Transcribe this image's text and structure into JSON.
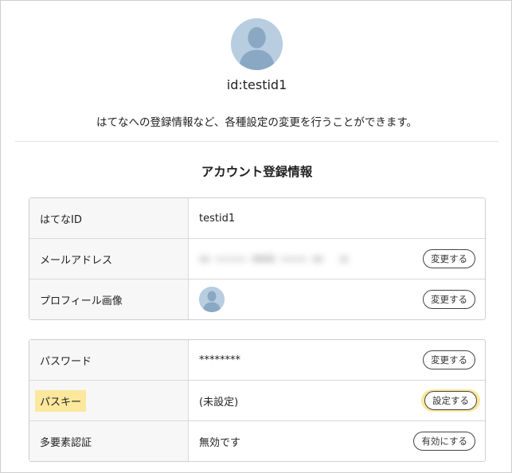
{
  "profile": {
    "user_id": "id:testid1",
    "description": "はてなへの登録情報など、各種設定の変更を行うことができます。",
    "avatar_icon": "user-silhouette-icon"
  },
  "account_section": {
    "title": "アカウント登録情報",
    "rows": [
      {
        "label": "はてなID",
        "value": "testid1"
      },
      {
        "label": "メールアドレス",
        "value": "",
        "button": "変更する"
      },
      {
        "label": "プロフィール画像",
        "avatar_icon": "user-silhouette-icon",
        "button": "変更する"
      }
    ]
  },
  "security_section": {
    "rows": [
      {
        "label": "パスワード",
        "value": "********",
        "button": "変更する"
      },
      {
        "label": "パスキー",
        "value": "(未設定)",
        "button": "設定する",
        "highlighted": true
      },
      {
        "label": "多要素認証",
        "value": "無効です",
        "button": "有効にする"
      }
    ]
  },
  "colors": {
    "highlight": "#fbe89c",
    "avatar_bg": "#b8cde0",
    "avatar_figure": "#8aa8c4",
    "border": "#cfcfcf",
    "label_bg": "#f7f7f7"
  }
}
